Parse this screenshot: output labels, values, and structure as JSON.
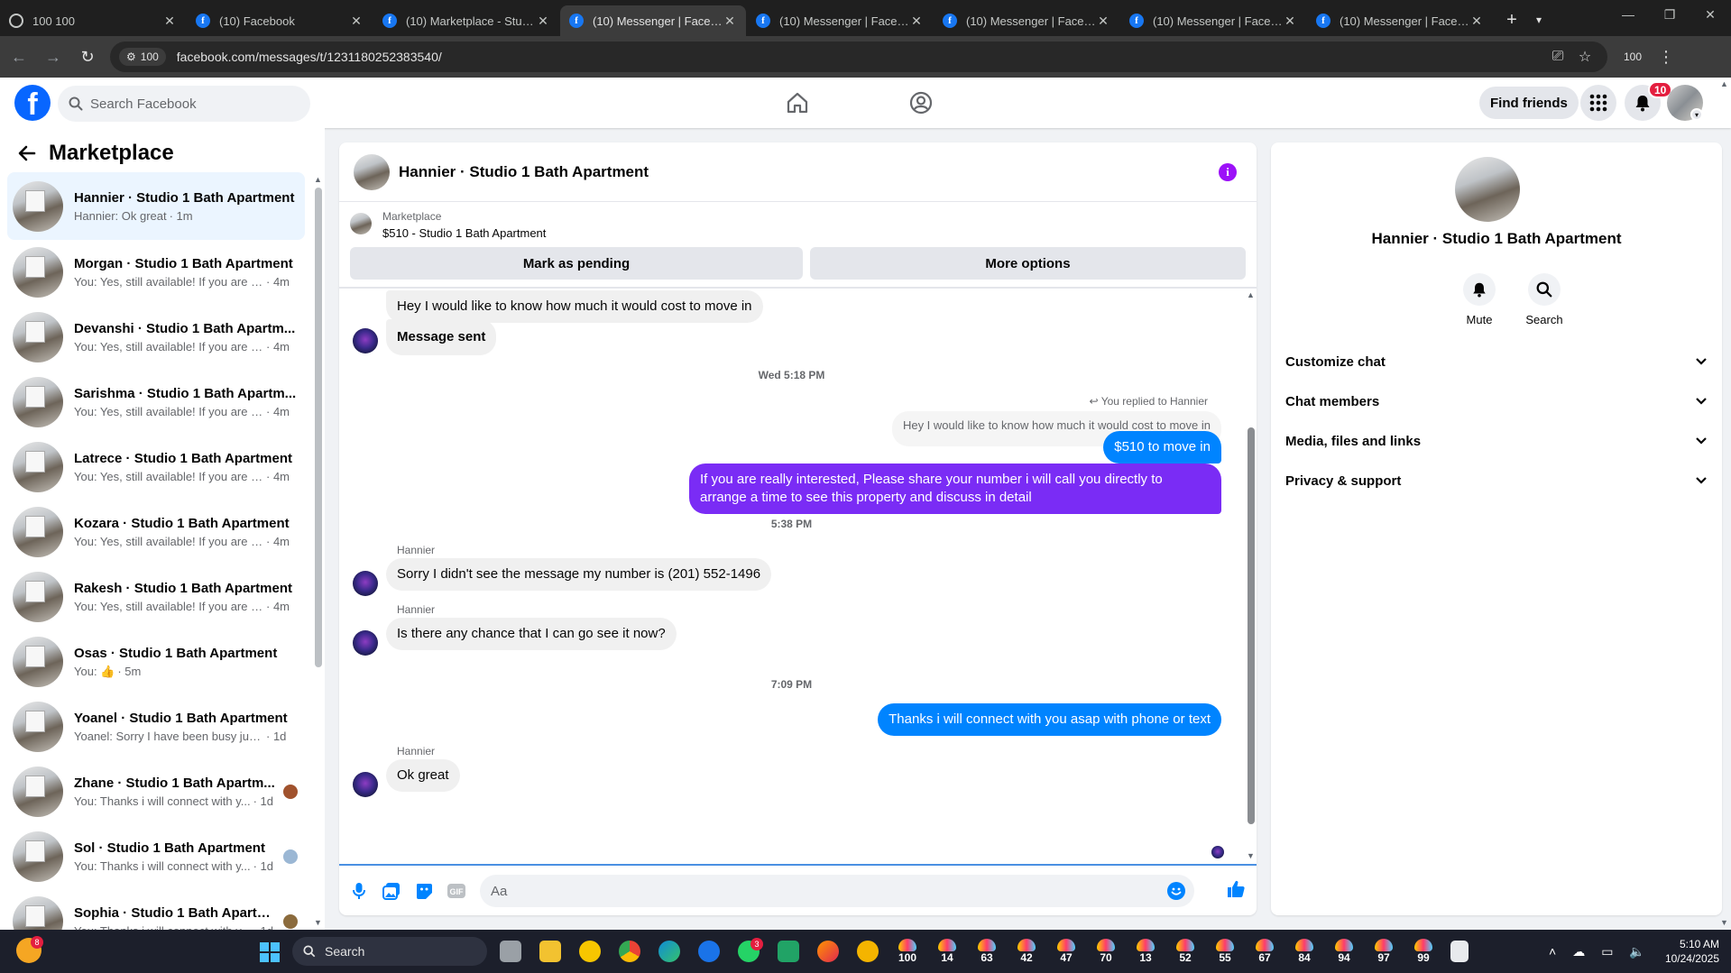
{
  "browser": {
    "tabs": [
      {
        "label": "100 100",
        "icon": "globe-icon"
      },
      {
        "label": "(10) Facebook",
        "icon": "facebook-icon"
      },
      {
        "label": "(10) Marketplace - Studio",
        "icon": "facebook-icon"
      },
      {
        "label": "(10) Messenger | Facebook",
        "icon": "facebook-icon",
        "active": true
      },
      {
        "label": "(10) Messenger | Facebook",
        "icon": "facebook-icon"
      },
      {
        "label": "(10) Messenger | Facebook",
        "icon": "facebook-icon"
      },
      {
        "label": "(10) Messenger | Facebook",
        "icon": "facebook-icon"
      },
      {
        "label": "(10) Messenger | Facebook",
        "icon": "facebook-icon"
      }
    ],
    "site_badge": "100",
    "url": "facebook.com/messages/t/1231180252383540/",
    "zoom_label": "100"
  },
  "fb_header": {
    "logo": "f",
    "search_placeholder": "Search Facebook",
    "find_friends": "Find friends",
    "notification_count": "10"
  },
  "sidebar": {
    "title": "Marketplace",
    "conversations": [
      {
        "name": "Hannier · Studio 1 Bath Apartment",
        "preview": "Hannier: Ok great",
        "time": "· 1m",
        "active": true
      },
      {
        "name": "Morgan · Studio 1 Bath Apartment",
        "preview": "You: Yes, still available! If you are r...",
        "time": "· 4m"
      },
      {
        "name": "Devanshi · Studio 1 Bath Apartm...",
        "preview": "You: Yes, still available! If you are r...",
        "time": "· 4m"
      },
      {
        "name": "Sarishma · Studio 1 Bath Apartm...",
        "preview": "You: Yes, still available! If you are r...",
        "time": "· 4m"
      },
      {
        "name": "Latrece · Studio 1 Bath Apartment",
        "preview": "You: Yes, still available! If you are r...",
        "time": "· 4m"
      },
      {
        "name": "Kozara · Studio 1 Bath Apartment",
        "preview": "You: Yes, still available! If you are r...",
        "time": "· 4m"
      },
      {
        "name": "Rakesh · Studio 1 Bath Apartment",
        "preview": "You: Yes, still available! If you are r...",
        "time": "· 4m"
      },
      {
        "name": "Osas · Studio 1 Bath Apartment",
        "preview": "You: 👍",
        "time": "· 5m"
      },
      {
        "name": "Yoanel · Studio 1 Bath Apartment",
        "preview": "Yoanel: Sorry I have been busy just ...",
        "time": "· 1d"
      },
      {
        "name": "Zhane · Studio 1 Bath Apartm...",
        "preview": "You: Thanks i will connect with y...",
        "time": "· 1d",
        "mini": "#a0522d"
      },
      {
        "name": "Sol · Studio 1 Bath Apartment",
        "preview": "You: Thanks i will connect with y...",
        "time": "· 1d",
        "mini": "#9bb7d4"
      },
      {
        "name": "Sophia · Studio 1 Bath Apartm...",
        "preview": "You: Thanks i will connect with y...",
        "time": "· 1d",
        "mini": "#8b6b3d"
      }
    ]
  },
  "chat": {
    "title": "Hannier · Studio 1 Bath Apartment",
    "listing_source": "Marketplace",
    "listing_title": "$510 - Studio 1 Bath Apartment",
    "mark_pending": "Mark as pending",
    "more_options": "More options",
    "messages": {
      "in1": "Hey I would like to know how much it would cost to move in",
      "in2": "Message sent",
      "ts1": "Wed 5:18 PM",
      "replied_note": "You replied to Hannier",
      "quoted": "Hey I would like to know how much it would cost to move in",
      "out1": "$510 to move in",
      "out2": "If you are really interested, Please share your number i will call you directly to arrange a time to see this property and discuss in detail",
      "ts2": "5:38 PM",
      "sender": "Hannier",
      "in3": "Sorry I didn't see the message my number is (201) 552-1496",
      "in4": "Is there any chance that I can go see it now?",
      "ts3": "7:09 PM",
      "out3": "Thanks i will  connect with you asap with phone or text",
      "in5": "Ok great"
    },
    "composer_placeholder": "Aa"
  },
  "details": {
    "name": "Hannier · Studio 1 Bath Apartment",
    "mute": "Mute",
    "search": "Search",
    "sections": [
      "Customize chat",
      "Chat members",
      "Media, files and links",
      "Privacy & support"
    ]
  },
  "taskbar": {
    "weather_badge": "8",
    "search_label": "Search",
    "whatsapp_badge": "3",
    "counters": [
      "100",
      "14",
      "63",
      "42",
      "47",
      "70",
      "13",
      "52",
      "55",
      "67",
      "84",
      "94",
      "97",
      "99"
    ],
    "time": "5:10 AM",
    "date": "10/24/2025"
  },
  "colors": {
    "fb_blue": "#0866ff",
    "bubble_out": "#0084ff",
    "bubble_out_purple": "#7a2cf5",
    "bubble_in": "#f0f0f0",
    "active_conv": "#ebf5ff"
  }
}
